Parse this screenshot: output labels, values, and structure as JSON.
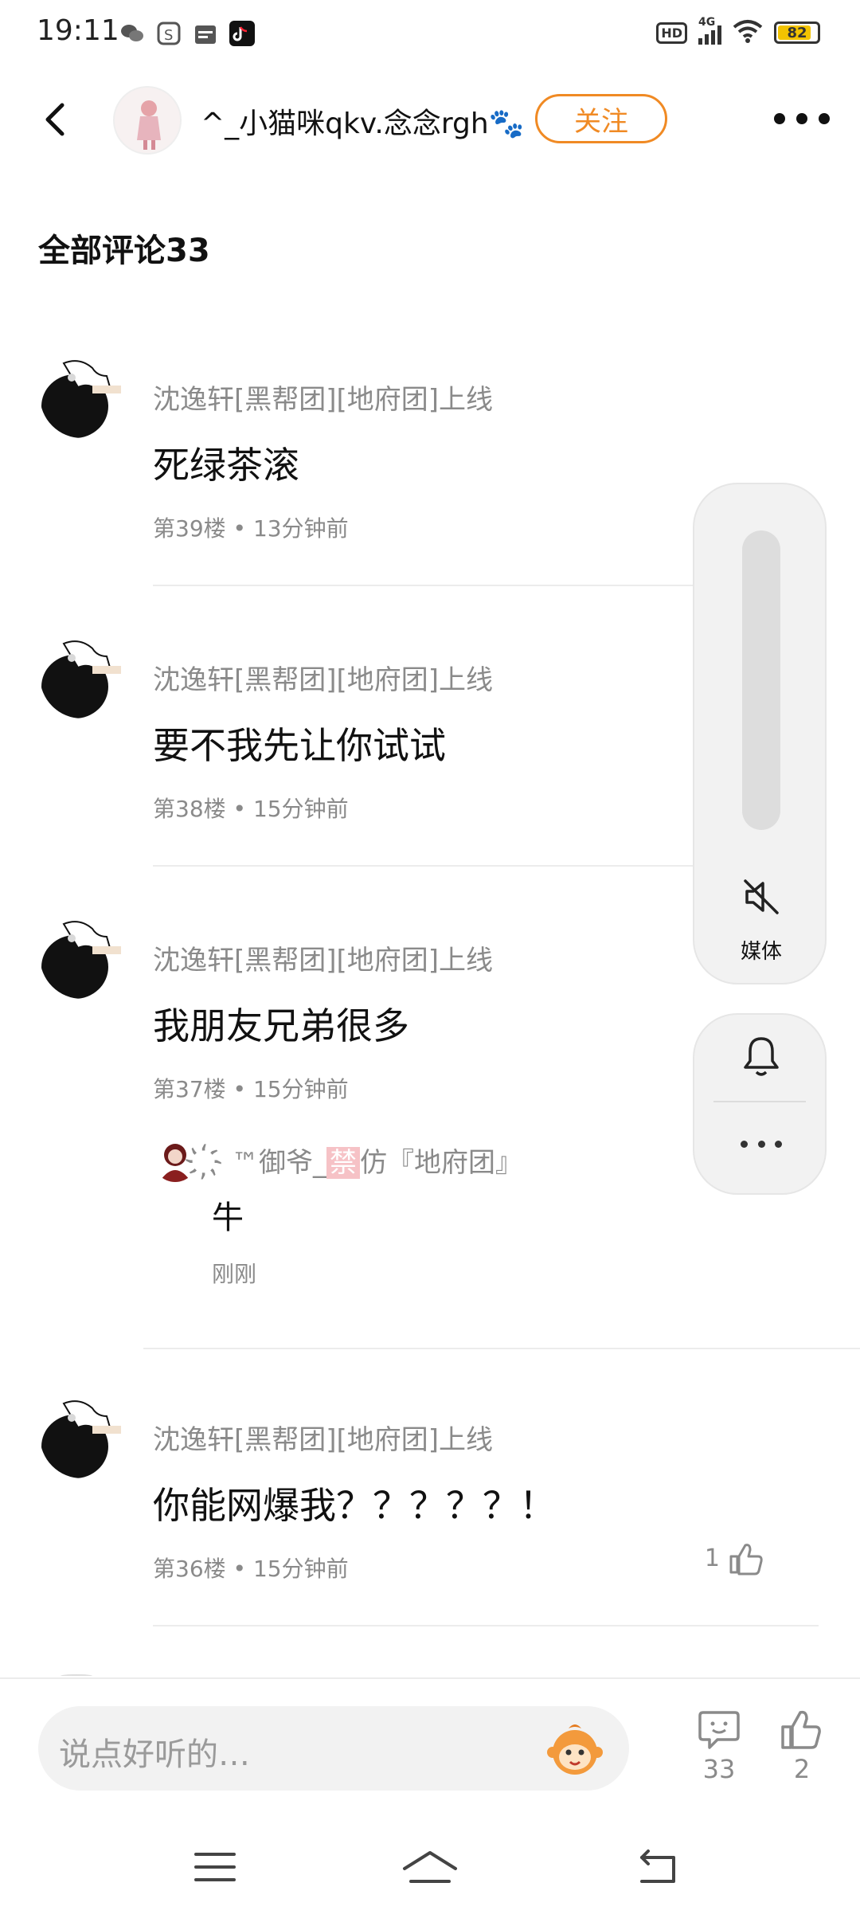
{
  "status_bar": {
    "time": "19:11",
    "hd": "HD",
    "network": "4G",
    "battery": "82"
  },
  "header": {
    "username": "^_小猫咪qkv.念念rgh🐾",
    "follow_label": "关注"
  },
  "section_title": "全部评论33",
  "comments": [
    {
      "author": "沈逸轩[黑帮团][地府团]上线",
      "text": "死绿茶滚",
      "meta": "第39楼 • 13分钟前"
    },
    {
      "author": "沈逸轩[黑帮团][地府团]上线",
      "text": "要不我先让你试试",
      "meta": "第38楼 • 15分钟前"
    },
    {
      "author": "沈逸轩[黑帮团][地府团]上线",
      "text": "我朋友兄弟很多",
      "meta": "第37楼 • 15分钟前",
      "reply": {
        "author_prefix": "҉ ™御爷_",
        "author_badge": "禁",
        "author_suffix": "仿『地府团』",
        "text": "牛",
        "time": "刚刚"
      }
    },
    {
      "author": "沈逸轩[黑帮团][地府团]上线",
      "text": "你能网爆我？？？？？！",
      "meta": "第36楼 • 15分钟前",
      "likes": "1"
    }
  ],
  "volume_panel": {
    "label": "媒体",
    "level": 0
  },
  "input_bar": {
    "placeholder": "说点好听的…",
    "comment_count": "33",
    "like_count": "2"
  },
  "colors": {
    "accent": "#f08a24",
    "muted_text": "#8a8a8a",
    "panel_bg": "#f2f2f2"
  },
  "icons": [
    "back-icon",
    "more-icon",
    "muted-speaker-icon",
    "bell-icon",
    "thumb-up-icon",
    "comment-bubble-icon",
    "emoji-face-icon",
    "menu-icon",
    "home-icon",
    "back-nav-icon"
  ]
}
